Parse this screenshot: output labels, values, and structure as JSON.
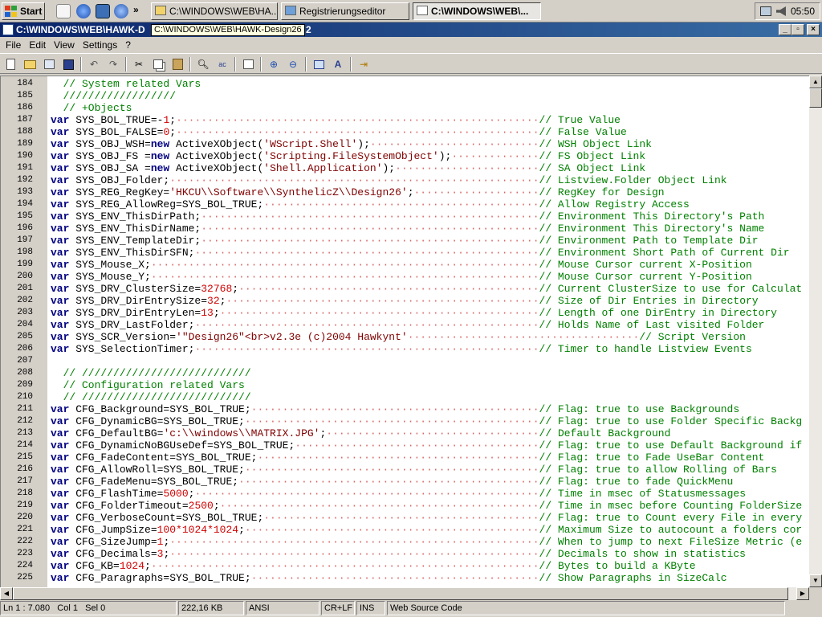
{
  "taskbar": {
    "start_label": "Start",
    "tasks": [
      {
        "label": "C:\\WINDOWS\\WEB\\HA..."
      },
      {
        "label": "Registrierungseditor"
      },
      {
        "label": "C:\\WINDOWS\\WEB\\..."
      }
    ],
    "clock": "05:50"
  },
  "window": {
    "title": "C:\\WINDOWS\\WEB\\HAWK-D",
    "title_suffix": "2",
    "tooltip": "C:\\WINDOWS\\WEB\\HAWK-Design26"
  },
  "menu": {
    "file": "File",
    "edit": "Edit",
    "view": "View",
    "settings": "Settings",
    "help": "?"
  },
  "code_lines": [
    {
      "n": "184",
      "code": "  // System related Vars",
      "type": "comment"
    },
    {
      "n": "185",
      "code": "  //////////////////",
      "type": "comment"
    },
    {
      "n": "186",
      "code": "  // +Objects",
      "type": "comment"
    },
    {
      "n": "187",
      "kw": "var",
      "code": " SYS_BOL_TRUE=-1;",
      "comment": "// True Value"
    },
    {
      "n": "188",
      "kw": "var",
      "code": " SYS_BOL_FALSE=0;",
      "comment": "// False Value"
    },
    {
      "n": "189",
      "kw": "var",
      "code": " SYS_OBJ_WSH=new ActiveXObject('WScript.Shell');",
      "comment": "// WSH Object Link"
    },
    {
      "n": "190",
      "kw": "var",
      "code": " SYS_OBJ_FS =new ActiveXObject('Scripting.FileSystemObject');",
      "comment": "// FS Object Link"
    },
    {
      "n": "191",
      "kw": "var",
      "code": " SYS_OBJ_SA =new ActiveXObject('Shell.Application');",
      "comment": "// SA Object Link"
    },
    {
      "n": "192",
      "kw": "var",
      "code": " SYS_OBJ_Folder;",
      "comment": "// Listview.Folder Object Link"
    },
    {
      "n": "193",
      "kw": "var",
      "code": " SYS_REG_RegKey='HKCU\\\\Software\\\\SynthelicZ\\\\Design26';",
      "comment": "// RegKey for Design"
    },
    {
      "n": "194",
      "kw": "var",
      "code": " SYS_REG_AllowReg=SYS_BOL_TRUE;",
      "comment": "// Allow Registry Access"
    },
    {
      "n": "195",
      "kw": "var",
      "code": " SYS_ENV_ThisDirPath;",
      "comment": "// Environment This Directory's Path"
    },
    {
      "n": "196",
      "kw": "var",
      "code": " SYS_ENV_ThisDirName;",
      "comment": "// Environment This Directory's Name"
    },
    {
      "n": "197",
      "kw": "var",
      "code": " SYS_ENV_TemplateDir;",
      "comment": "// Environment Path to Template Dir"
    },
    {
      "n": "198",
      "kw": "var",
      "code": " SYS_ENV_ThisDirSFN;",
      "comment": "// Environment Short Path of Current Dir"
    },
    {
      "n": "199",
      "kw": "var",
      "code": " SYS_Mouse_X;",
      "comment": "// Mouse Cursor current X-Position"
    },
    {
      "n": "200",
      "kw": "var",
      "code": " SYS_Mouse_Y;",
      "comment": "// Mouse Cursor current Y-Position"
    },
    {
      "n": "201",
      "kw": "var",
      "code": " SYS_DRV_ClusterSize=32768;",
      "comment": "// Current ClusterSize to use for Calculat"
    },
    {
      "n": "202",
      "kw": "var",
      "code": " SYS_DRV_DirEntrySize=32;",
      "comment": "// Size of Dir Entries in Directory"
    },
    {
      "n": "203",
      "kw": "var",
      "code": " SYS_DRV_DirEntryLen=13;",
      "comment": "// Length of one DirEntry in Directory"
    },
    {
      "n": "204",
      "kw": "var",
      "code": " SYS_DRV_LastFolder;",
      "comment": "// Holds Name of Last visited Folder"
    },
    {
      "n": "205",
      "kw": "var",
      "code": " SYS_SCR_Version='\"Design26\"<br>v2.3e (c)2004 Hawkynt'",
      "comment": "// Script Version",
      "far": true
    },
    {
      "n": "206",
      "kw": "var",
      "code": " SYS_SelectionTimer;",
      "comment": "// Timer to handle Listview Events"
    },
    {
      "n": "207",
      "code": "",
      "type": "blank"
    },
    {
      "n": "208",
      "code": "  // ///////////////////////////",
      "type": "comment"
    },
    {
      "n": "209",
      "code": "  // Configuration related Vars",
      "type": "comment"
    },
    {
      "n": "210",
      "code": "  // ///////////////////////////",
      "type": "comment"
    },
    {
      "n": "211",
      "kw": "var",
      "code": " CFG_Background=SYS_BOL_TRUE;",
      "comment": "// Flag: true to use Backgrounds"
    },
    {
      "n": "212",
      "kw": "var",
      "code": " CFG_DynamicBG=SYS_BOL_TRUE;",
      "comment": "// Flag: true to use Folder Specific Backg"
    },
    {
      "n": "213",
      "kw": "var",
      "code": " CFG_DefaultBG='c:\\\\windows\\\\MATRIX.JPG';",
      "comment": "// Default Background"
    },
    {
      "n": "214",
      "kw": "var",
      "code": " CFG_DynamicNoBGUseDef=SYS_BOL_TRUE;",
      "comment": "// Flag: true to use Default Background if"
    },
    {
      "n": "215",
      "kw": "var",
      "code": " CFG_FadeContent=SYS_BOL_TRUE;",
      "comment": "// Flag: true to Fade UseBar Content"
    },
    {
      "n": "216",
      "kw": "var",
      "code": " CFG_AllowRoll=SYS_BOL_TRUE;",
      "comment": "// Flag: true to allow Rolling of Bars"
    },
    {
      "n": "217",
      "kw": "var",
      "code": " CFG_FadeMenu=SYS_BOL_TRUE;",
      "comment": "// Flag: true to fade QuickMenu"
    },
    {
      "n": "218",
      "kw": "var",
      "code": " CFG_FlashTime=5000;",
      "comment": "// Time in msec of Statusmessages"
    },
    {
      "n": "219",
      "kw": "var",
      "code": " CFG_FolderTimeout=2500;",
      "comment": "// Time in msec before Counting FolderSize"
    },
    {
      "n": "220",
      "kw": "var",
      "code": " CFG_VerboseCount=SYS_BOL_TRUE;",
      "comment": "// Flag: true to Count every File in every"
    },
    {
      "n": "221",
      "kw": "var",
      "code": " CFG_JumpSize=100*1024*1024;",
      "comment": "// Maximum Size to autocount a folders cor"
    },
    {
      "n": "222",
      "kw": "var",
      "code": " CFG_SizeJump=1;",
      "comment": "// When to jump to next FileSize Metric (e"
    },
    {
      "n": "223",
      "kw": "var",
      "code": " CFG_Decimals=3;",
      "comment": "// Decimals to show in statistics"
    },
    {
      "n": "224",
      "kw": "var",
      "code": " CFG_KB=1024;",
      "comment": "// Bytes to build a KByte"
    },
    {
      "n": "225",
      "kw": "var",
      "code": " CFG_Paragraphs=SYS_BOL_TRUE;",
      "comment": "// Show Paragraphs in SizeCalc"
    }
  ],
  "statusbar": {
    "position": "Ln 1 : 7.080",
    "col": "Col 1",
    "sel": "Sel 0",
    "size": "222,16 KB",
    "encoding": "ANSI",
    "line_end": "CR+LF",
    "mode": "INS",
    "scheme": "Web Source Code"
  }
}
